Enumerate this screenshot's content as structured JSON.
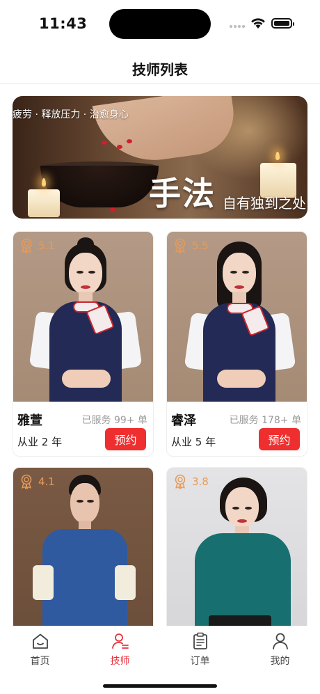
{
  "status_bar": {
    "time": "11:43",
    "icons": [
      "signal-icon",
      "wifi-icon",
      "battery-icon"
    ]
  },
  "nav": {
    "title": "技师列表"
  },
  "banner": {
    "top_text": "疲劳 · 释放压力 · 治愈身心",
    "big_text": "手法",
    "sub_text": "自有独到之处"
  },
  "technicians": [
    {
      "rating": "5.1",
      "name": "雅萱",
      "served": "已服务 99+ 单",
      "years": "从业 2 年",
      "book_label": "预约",
      "icon": "award-icon"
    },
    {
      "rating": "5.5",
      "name": "睿泽",
      "served": "已服务 178+ 单",
      "years": "从业 5 年",
      "book_label": "预约",
      "icon": "award-icon"
    },
    {
      "rating": "4.1",
      "icon": "award-icon"
    },
    {
      "rating": "3.8",
      "icon": "award-icon"
    }
  ],
  "tabs": [
    {
      "label": "首页",
      "icon": "home-icon",
      "active": false
    },
    {
      "label": "技师",
      "icon": "technician-icon",
      "active": true
    },
    {
      "label": "订单",
      "icon": "order-icon",
      "active": false
    },
    {
      "label": "我的",
      "icon": "profile-icon",
      "active": false
    }
  ],
  "colors": {
    "accent": "#ef2f2f",
    "active_tab": "#e8333d",
    "rating": "#e59a5b",
    "muted_text": "#9a9a9a"
  }
}
